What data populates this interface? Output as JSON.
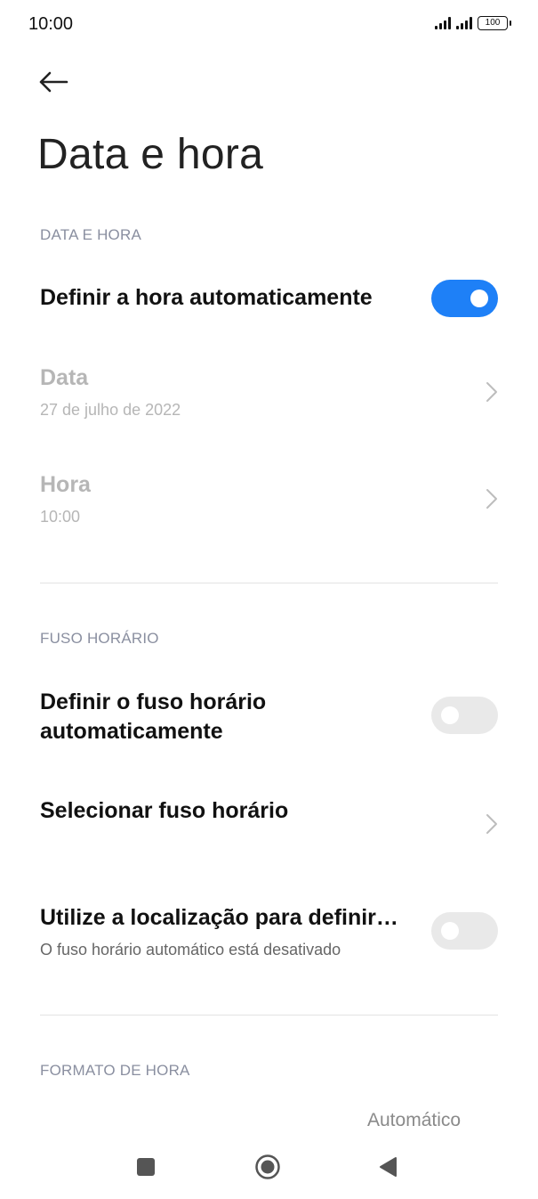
{
  "status_bar": {
    "time": "10:00",
    "battery": "100"
  },
  "header": {
    "title": "Data e hora"
  },
  "section_date_time": {
    "header": "DATA E HORA",
    "auto_time": {
      "title": "Definir a hora automaticamente",
      "enabled": true
    },
    "date": {
      "title": "Data",
      "value": "27 de julho de 2022"
    },
    "time": {
      "title": "Hora",
      "value": "10:00"
    }
  },
  "section_timezone": {
    "header": "FUSO HORÁRIO",
    "auto_timezone": {
      "title_line1": "Definir o fuso horário",
      "title_line2": "automaticamente",
      "enabled": false
    },
    "select_timezone": {
      "title": "Selecionar fuso horário"
    },
    "use_location": {
      "title": "Utilize a localização para definir…",
      "subtitle": "O fuso horário automático está desativado",
      "enabled": false
    }
  },
  "section_time_format": {
    "header": "FORMATO DE HORA",
    "value": "Automático"
  },
  "colors": {
    "accent": "#1e80f7",
    "section_header": "#8a8fa0",
    "disabled_text": "#b6b6b6"
  },
  "icons": {
    "back": "arrow-left-icon",
    "chevron": "chevron-right-icon",
    "nav_recents": "square-icon",
    "nav_home": "circle-icon",
    "nav_back": "triangle-left-icon"
  }
}
